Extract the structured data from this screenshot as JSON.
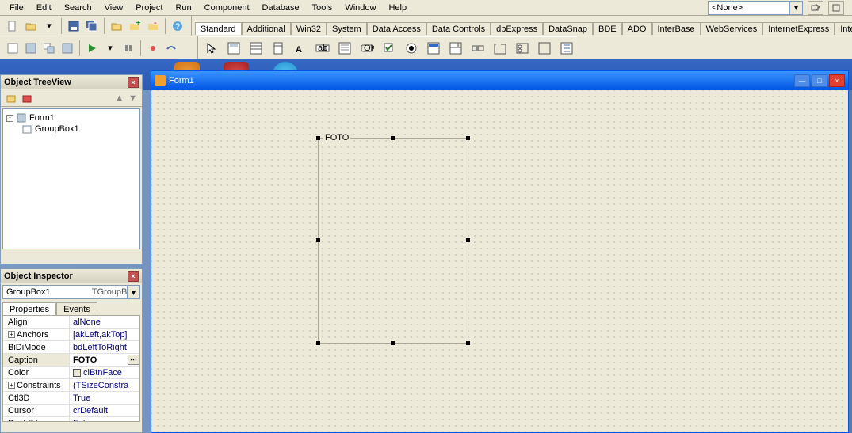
{
  "menu": [
    "File",
    "Edit",
    "Search",
    "View",
    "Project",
    "Run",
    "Component",
    "Database",
    "Tools",
    "Window",
    "Help"
  ],
  "top_combo_value": "<None>",
  "palette_tabs": [
    "Standard",
    "Additional",
    "Win32",
    "System",
    "Data Access",
    "Data Controls",
    "dbExpress",
    "DataSnap",
    "BDE",
    "ADO",
    "InterBase",
    "WebServices",
    "InternetExpress",
    "Internet"
  ],
  "active_palette_tab": "Standard",
  "treeview": {
    "title": "Object TreeView",
    "root": "Form1",
    "child": "GroupBox1"
  },
  "inspector": {
    "title": "Object Inspector",
    "object_name": "GroupBox1",
    "object_type": "TGroupBox",
    "tabs": [
      "Properties",
      "Events"
    ],
    "active_tab": "Properties",
    "props": [
      {
        "name": "Align",
        "val": "alNone",
        "exp": ""
      },
      {
        "name": "Anchors",
        "val": "[akLeft,akTop]",
        "exp": "+"
      },
      {
        "name": "BiDiMode",
        "val": "bdLeftToRight",
        "exp": ""
      },
      {
        "name": "Caption",
        "val": "FOTO",
        "exp": "",
        "sel": true
      },
      {
        "name": "Color",
        "val": "clBtnFace",
        "exp": "",
        "swatch": true
      },
      {
        "name": "Constraints",
        "val": "(TSizeConstra",
        "exp": "+"
      },
      {
        "name": "Ctl3D",
        "val": "True",
        "exp": ""
      },
      {
        "name": "Cursor",
        "val": "crDefault",
        "exp": ""
      },
      {
        "name": "DockSite",
        "val": "False",
        "exp": ""
      }
    ]
  },
  "form": {
    "title": "Form1",
    "groupbox_caption": "FOTO"
  }
}
